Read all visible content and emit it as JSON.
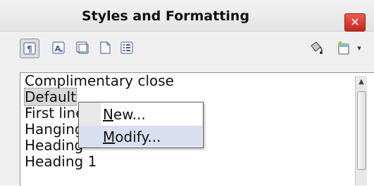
{
  "panel": {
    "title": "Styles and Formatting",
    "close_icon": "close-icon"
  },
  "toolbar": {
    "buttons": [
      {
        "icon": "paragraph-styles-icon",
        "active": true
      },
      {
        "icon": "character-styles-icon",
        "active": false
      },
      {
        "icon": "frame-styles-icon",
        "active": false
      },
      {
        "icon": "page-styles-icon",
        "active": false
      },
      {
        "icon": "list-styles-icon",
        "active": false
      }
    ],
    "right": [
      {
        "icon": "fill-format-mode-icon"
      },
      {
        "icon": "new-style-from-selection-icon"
      }
    ]
  },
  "styles_list": {
    "items": [
      "Complimentary close",
      "Default",
      "First line indent",
      "Hanging indent",
      "Heading",
      "Heading 1"
    ],
    "selected": "Default"
  },
  "context_menu": {
    "items": [
      {
        "label": "New...",
        "underline": "N"
      },
      {
        "label": "Modify...",
        "underline": "M"
      }
    ],
    "hover": "Modify..."
  },
  "colors": {
    "close_button": "#d93a2e",
    "menu_hover": "#d9dff0"
  }
}
